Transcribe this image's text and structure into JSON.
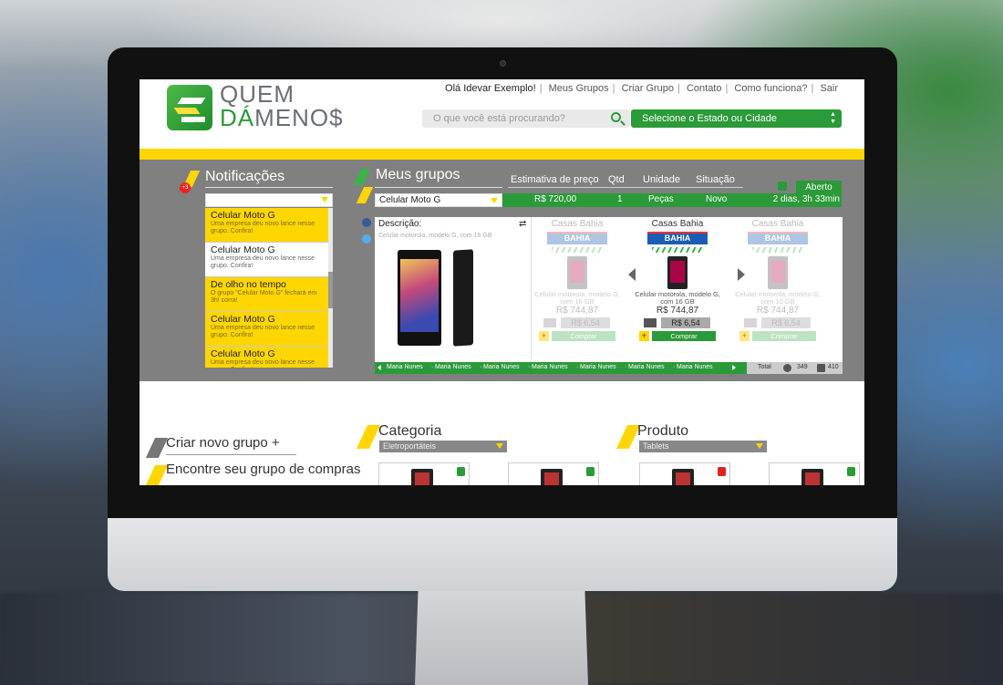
{
  "brand": {
    "line1": "QUEM",
    "line2_bold": "DÁ",
    "line2_rest": "MENO$"
  },
  "topnav": {
    "greeting": "Olá Idevar Exemplo!",
    "items": [
      "Meus Grupos",
      "Criar Grupo",
      "Contato",
      "Como funciona?",
      "Sair"
    ]
  },
  "search": {
    "placeholder": "O que você está procurando?"
  },
  "state_select": {
    "label": "Selecione o Estado ou Cidade"
  },
  "notifications": {
    "title": "Notificações",
    "badge": "+3",
    "items": [
      {
        "title": "Celular Moto G",
        "desc": "Uma empresa deu novo lance nesse grupo. Confira!",
        "style": "yellow"
      },
      {
        "title": "Celular Moto G",
        "desc": "Uma empresa deu novo lance nesse grupo. Confira!",
        "style": "white"
      },
      {
        "title": "De olho no tempo",
        "desc": "O grupo \"Celular Moto G\" fechará em 3h! corra!",
        "style": "yellow"
      },
      {
        "title": "Celular Moto G",
        "desc": "Uma empresa deu novo lance nesse grupo. Confira!",
        "style": "yellow"
      },
      {
        "title": "Celular Moto G",
        "desc": "Uma empresa deu novo lance nesse grupo. Confira!",
        "style": "yellow"
      }
    ]
  },
  "groups": {
    "title": "Meus grupos",
    "columns": [
      "Estimativa de preço",
      "Qtd",
      "Unidade",
      "Situação"
    ],
    "status": "Aberto",
    "selected": "Celular Moto G",
    "row": {
      "price": "R$ 720,00",
      "qty": "1",
      "unit": "Peças",
      "situation": "Novo",
      "time_left": "2 dias, 3h 33min"
    },
    "description_label": "Descrição:",
    "description": "Celular motorola, modelo G, com 16 GB",
    "offers": [
      {
        "store": "Casas Bahia",
        "logo": "BAHIA",
        "product": "Celular motorola, modelo G, com 16 GB",
        "price": "R$ 744,87",
        "shipping": "R$ 6,54",
        "buy": "Comprar",
        "active": false
      },
      {
        "store": "Casas Bahia",
        "logo": "BAHIA",
        "product": "Celular motorola, modelo G, com 16 GB",
        "price": "R$ 744,87",
        "shipping": "R$ 6,54",
        "buy": "Comprar",
        "active": true
      },
      {
        "store": "Casas Bahia",
        "logo": "BAHIA",
        "product": "Celular motorola, modelo G, com 16 GB",
        "price": "R$ 744,87",
        "shipping": "R$ 6,54",
        "buy": "Comprar",
        "active": false
      }
    ],
    "members": [
      "Maria Nunes",
      "Maria Nunes",
      "Maria Nunes",
      "Maria Nunes",
      "Maria Nunes",
      "Maria Nunes",
      "Maria Nunes"
    ],
    "totals": {
      "label": "Total",
      "users": "349",
      "items": "410"
    }
  },
  "lower": {
    "create": "Criar novo grupo +",
    "find": "Encontre seu grupo de compras",
    "category": {
      "title": "Categoria",
      "selected": "Eletroportáteis"
    },
    "product": {
      "title": "Produto",
      "selected": "Tablets"
    }
  },
  "colors": {
    "green": "#2b9a38",
    "yellow": "#ffd600",
    "gray": "#808080"
  }
}
